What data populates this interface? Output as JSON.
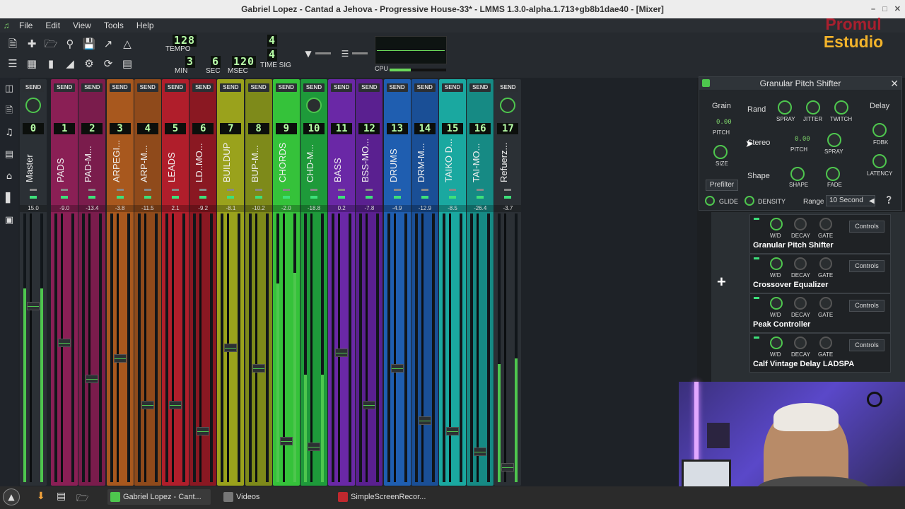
{
  "window": {
    "title": "Gabriel Lopez - Cantad a Jehova - Progressive House-33* - LMMS 1.3.0-alpha.1.713+gb8b1dae40 - [Mixer]"
  },
  "menu": [
    "File",
    "Edit",
    "View",
    "Tools",
    "Help"
  ],
  "transport": {
    "tempo": "128",
    "tempo_label": "TEMPO",
    "min": "3",
    "sec": "6",
    "msec": "120",
    "min_label": "MIN",
    "sec_label": "SEC",
    "msec_label": "MSEC",
    "timesig_num": "4",
    "timesig_den": "4",
    "timesig_label": "TIME SIG",
    "cpu_label": "CPU",
    "cpu_load": 0.38
  },
  "branding": {
    "line1": "Promul",
    "line2": "Estudio"
  },
  "mixer": {
    "send_label": "SEND",
    "channels": [
      {
        "num": "0",
        "name": "Master",
        "db": "15.0",
        "color": "#2b3035",
        "fader": 0.66,
        "meter": 0.72,
        "meter2": 0.72
      },
      {
        "num": "1",
        "name": "PADS",
        "db": "-9.0",
        "color": "#8a1f55",
        "fader": 0.52,
        "meter": 0,
        "meter2": 0
      },
      {
        "num": "2",
        "name": "PAD-M...",
        "db": "-13.4",
        "color": "#7a1c4c",
        "fader": 0.38,
        "meter": 0,
        "meter2": 0
      },
      {
        "num": "3",
        "name": "ARPEGI...",
        "db": "-3.8",
        "color": "#a8581e",
        "fader": 0.46,
        "meter": 0,
        "meter2": 0
      },
      {
        "num": "4",
        "name": "ARP-M...",
        "db": "-11.5",
        "color": "#8f4a1b",
        "fader": 0.28,
        "meter": 0,
        "meter2": 0
      },
      {
        "num": "5",
        "name": "LEADS",
        "db": "2.1",
        "color": "#b01e2b",
        "fader": 0.28,
        "meter": 0,
        "meter2": 0
      },
      {
        "num": "6",
        "name": "LD..MO...",
        "db": "-9.2",
        "color": "#8a1822",
        "fader": 0.18,
        "meter": 0,
        "meter2": 0
      },
      {
        "num": "7",
        "name": "BUILDUP",
        "db": "-8.1",
        "color": "#9aa21c",
        "fader": 0.5,
        "meter": 0,
        "meter2": 0
      },
      {
        "num": "8",
        "name": "BUP-M...",
        "db": "-10.2",
        "color": "#7e8a1a",
        "fader": 0.42,
        "meter": 0,
        "meter2": 0
      },
      {
        "num": "9",
        "name": "CHORDS",
        "db": "-2.0",
        "color": "#35c23a",
        "fader": 0.14,
        "meter": 0.74,
        "meter2": 0.78
      },
      {
        "num": "10",
        "name": "CHD-M...",
        "db": "-18.8",
        "color": "#1e9a3a",
        "fader": 0.12,
        "meter": 0.4,
        "meter2": 0.4
      },
      {
        "num": "11",
        "name": "BASS",
        "db": "0.2",
        "color": "#6a28a6",
        "fader": 0.48,
        "meter": 0,
        "meter2": 0
      },
      {
        "num": "12",
        "name": "BSS-MO...",
        "db": "-7.8",
        "color": "#5a2090",
        "fader": 0.28,
        "meter": 0,
        "meter2": 0
      },
      {
        "num": "13",
        "name": "DRUMS",
        "db": "-4.9",
        "color": "#1f5eb0",
        "fader": 0.42,
        "meter": 0,
        "meter2": 0
      },
      {
        "num": "14",
        "name": "DRM-M...",
        "db": "-12.9",
        "color": "#1a4f96",
        "fader": 0.22,
        "meter": 0,
        "meter2": 0
      },
      {
        "num": "15",
        "name": "TAIKO D...",
        "db": "-8.5",
        "color": "#1aa8a0",
        "fader": 0.18,
        "meter": 0,
        "meter2": 0
      },
      {
        "num": "16",
        "name": "TAI-MO...",
        "db": "-26.4",
        "color": "#168a84",
        "fader": 0.1,
        "meter": 0,
        "meter2": 0
      },
      {
        "num": "17",
        "name": "Refuerz...",
        "db": "-3.7",
        "color": "#2b3035",
        "fader": 0.04,
        "meter": 0.44,
        "meter2": 0.46
      }
    ]
  },
  "fx_rack": {
    "add_label": "+",
    "knob_labels": [
      "W/D",
      "DECAY",
      "GATE"
    ],
    "controls_label": "Controls",
    "effects": [
      {
        "name": "Granular Pitch Shifter"
      },
      {
        "name": "Crossover Equalizer"
      },
      {
        "name": "Peak Controller"
      },
      {
        "name": "Calf Vintage Delay LADSPA"
      }
    ]
  },
  "granular": {
    "title": "Granular Pitch Shifter",
    "grain": "Grain",
    "grain_pitch_value": "0.00",
    "pitch": "PITCH",
    "size": "SIZE",
    "rand": "Rand",
    "spray": "SPRAY",
    "jitter": "JITTER",
    "twitch": "TWITCH",
    "stereo": "Stereo",
    "stereo_pitch_value": "0.00",
    "shape": "Shape",
    "shape_knob": "SHAPE",
    "fade": "FADE",
    "delay": "Delay",
    "fdbk": "FDBK",
    "latency": "LATENCY",
    "prefilter": "Prefilter",
    "glide": "GLIDE",
    "density": "DENSITY",
    "range_label": "Range",
    "range_value": "10 Second"
  },
  "taskbar": {
    "items": [
      {
        "label": "Gabriel Lopez - Cant..."
      },
      {
        "label": "Videos"
      },
      {
        "label": "SimpleScreenRecor..."
      }
    ]
  }
}
